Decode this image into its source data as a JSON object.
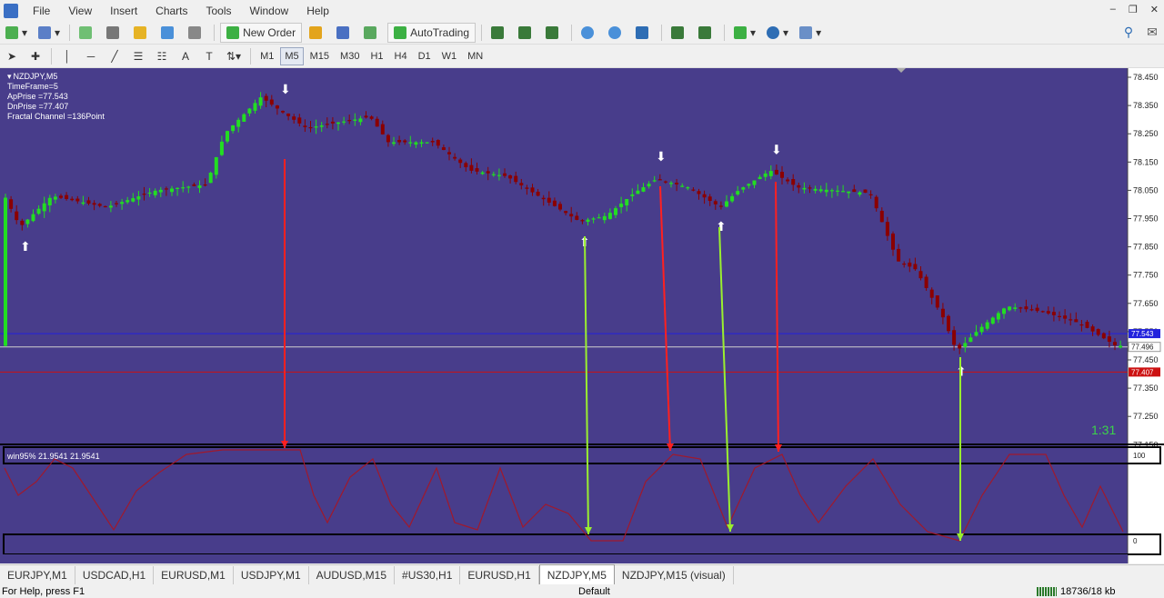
{
  "menu": [
    "File",
    "View",
    "Insert",
    "Charts",
    "Tools",
    "Window",
    "Help"
  ],
  "toolbar": {
    "new_order": "New Order",
    "autotrading": "AutoTrading"
  },
  "timeframes": [
    {
      "label": "M1",
      "active": false
    },
    {
      "label": "M5",
      "active": true
    },
    {
      "label": "M15",
      "active": false
    },
    {
      "label": "M30",
      "active": false
    },
    {
      "label": "H1",
      "active": false
    },
    {
      "label": "H4",
      "active": false
    },
    {
      "label": "D1",
      "active": false
    },
    {
      "label": "W1",
      "active": false
    },
    {
      "label": "MN",
      "active": false
    }
  ],
  "chart_info": {
    "symbol": "NZDJPY,M5",
    "timeframe": "TimeFrame=5",
    "ap_price": "ApPrise =77.543",
    "dn_price": "DnPrise =77.407",
    "channel": "Fractal Channel =136Point"
  },
  "timer": "1:31",
  "indicator": {
    "label": "win95% 21.9541 21.9541",
    "level_top": "100",
    "level_bottom": "0"
  },
  "chart_data": {
    "type": "line",
    "y_ticks": [
      "78.450",
      "78.350",
      "78.250",
      "78.150",
      "78.050",
      "77.950",
      "77.850",
      "77.750",
      "77.650",
      "77.550",
      "77.450",
      "77.350",
      "77.250",
      "77.150"
    ],
    "ylim": [
      77.15,
      78.45
    ],
    "price_labels": {
      "ap": "77.543",
      "current": "77.496",
      "dn": "77.407"
    },
    "colors": {
      "background": "#483d8b",
      "bull": "#22dd22",
      "bear": "#8b0000",
      "ap_line": "#2222dd",
      "dn_line": "#cc1111",
      "current_line": "#cfcfcf",
      "arrow_up": "#9aef2f",
      "arrow_down": "#ff2020",
      "oscillator": "#a0192c"
    }
  },
  "tabs": [
    {
      "label": "EURJPY,M1",
      "active": false
    },
    {
      "label": "USDCAD,H1",
      "active": false
    },
    {
      "label": "EURUSD,M1",
      "active": false
    },
    {
      "label": "USDJPY,M1",
      "active": false
    },
    {
      "label": "AUDUSD,M15",
      "active": false
    },
    {
      "label": "#US30,H1",
      "active": false
    },
    {
      "label": "EURUSD,H1",
      "active": false
    },
    {
      "label": "NZDJPY,M5",
      "active": true
    },
    {
      "label": "NZDJPY,M15 (visual)",
      "active": false
    }
  ],
  "status": {
    "help": "For Help, press F1",
    "profile": "Default",
    "traffic": "18736/18 kb"
  }
}
